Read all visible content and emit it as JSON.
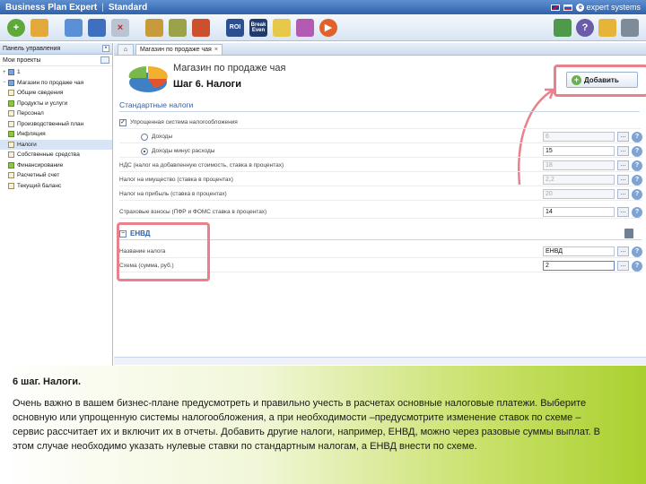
{
  "app": {
    "name": "Business Plan Expert",
    "edition": "Standard",
    "brand": "expert systems"
  },
  "toolbar": {
    "left_icons": [
      "add-icon",
      "folder-icon",
      "copy-icon",
      "save-icon",
      "delete-icon",
      "scales-icon",
      "sack-icon",
      "export-icon",
      "roi-icon",
      "break-even-icon",
      "notes-icon",
      "puzzle-icon",
      "play-icon"
    ],
    "roi_label": "ROI",
    "breakeven_label": "Break Even",
    "right_icons": [
      "users-icon",
      "help-icon",
      "edit-icon",
      "exit-icon"
    ]
  },
  "left_panel": {
    "title": "Панель управления",
    "projects_label": "Мои проекты",
    "tree": [
      {
        "level": 0,
        "label": "1",
        "toggle": "+"
      },
      {
        "level": 0,
        "label": "Магазин по продаже чая",
        "toggle": "−"
      },
      {
        "level": 1,
        "label": "Общие сведения"
      },
      {
        "level": 1,
        "label": "Продукты и услуги"
      },
      {
        "level": 1,
        "label": "Персонал"
      },
      {
        "level": 1,
        "label": "Производственный план"
      },
      {
        "level": 1,
        "label": "Инфляция"
      },
      {
        "level": 1,
        "label": "Налоги",
        "selected": true
      },
      {
        "level": 1,
        "label": "Собственные средства"
      },
      {
        "level": 1,
        "label": "Финансирование"
      },
      {
        "level": 1,
        "label": "Расчетный счет"
      },
      {
        "level": 1,
        "label": "Текущий баланс"
      }
    ]
  },
  "tabs": [
    {
      "label": "Магазин по продаже чая",
      "close": "×"
    }
  ],
  "main": {
    "company": "Магазин по продаже чая",
    "step": "Шаг 6. Налоги",
    "add_button": "Добавить",
    "section_title": "Стандартные налоги",
    "rows": [
      {
        "label": "Упрощенная система налогообложения",
        "control": "checkbox",
        "checked": true,
        "value": ""
      },
      {
        "label": "Доходы",
        "control": "radio",
        "selected": false,
        "value": "6",
        "disabled": true
      },
      {
        "label": "Доходы минус расходы",
        "control": "radio",
        "selected": true,
        "value": "15",
        "disabled": false
      },
      {
        "label": "НДС (налог на добавленную стоимость, ставка в процентах)",
        "value": "18",
        "disabled": true
      },
      {
        "label": "Налог на имущество (ставка в процентах)",
        "value": "2,2",
        "disabled": true
      },
      {
        "label": "Налог на прибыль (ставка в процентах)",
        "value": "20",
        "disabled": true
      },
      {
        "label": "Страховые взносы (ПФР и ФОМС ставка в процентах)",
        "value": "14",
        "disabled": false
      }
    ],
    "envd": {
      "title": "ЕНВД",
      "toggle": "−",
      "rows": [
        {
          "label": "Название налога",
          "value": "ЕНВД"
        },
        {
          "label": "Схема (сумма, руб.)",
          "value": "2"
        }
      ]
    }
  },
  "caption": {
    "title": "6 шаг. Налоги.",
    "text": "Очень важно в вашем бизнес-плане предусмотреть и правильно учесть в расчетах основные налоговые платежи. Выберите основную или упрощенную системы налогообложения, а при необходимости –предусмотрите изменение ставок по схеме – сервис рассчитает их и включит их в отчеты. Добавить другие налоги, например, ЕНВД, можно через разовые суммы выплат. В этом случае необходимо указать нулевые ставки по стандартным налогам, а ЕНВД внести по схеме."
  },
  "colors": {
    "title_bar": "#2f62ad",
    "accent_blue": "#2f62ad",
    "highlight": "#e8818c",
    "caption_green": "#a9d02e"
  }
}
